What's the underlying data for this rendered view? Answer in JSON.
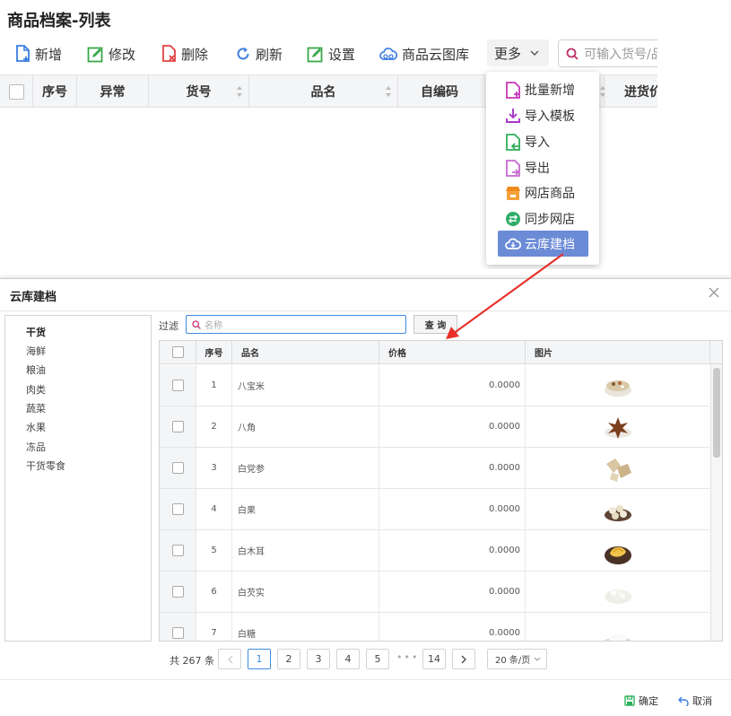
{
  "page": {
    "title": "商品档案-列表",
    "toolbar": {
      "add": "新增",
      "edit": "修改",
      "delete": "删除",
      "refresh": "刷新",
      "settings": "设置",
      "cloud_gallery": "商品云图库",
      "more": "更多",
      "search_placeholder": "可输入货号/品名"
    },
    "columns": [
      "序号",
      "异常",
      "货号",
      "品名",
      "自编码",
      "进货价"
    ]
  },
  "more_menu": [
    {
      "label": "批量新增",
      "icon": "batch-add-icon"
    },
    {
      "label": "导入模板",
      "icon": "download-icon"
    },
    {
      "label": "导入",
      "icon": "import-icon"
    },
    {
      "label": "导出",
      "icon": "export-icon"
    },
    {
      "label": "网店商品",
      "icon": "shop-icon"
    },
    {
      "label": "同步网店",
      "icon": "sync-icon"
    },
    {
      "label": "云库建档",
      "icon": "cloud-icon"
    }
  ],
  "colors": {
    "accent": "#3f8ce0",
    "menu_active": "#6b8bd6",
    "arrow": "#e8302a"
  },
  "modal": {
    "title": "云库建档",
    "categories": [
      "干货",
      "海鲜",
      "粮油",
      "肉类",
      "蔬菜",
      "水果",
      "冻品",
      "干货零食"
    ],
    "filter_label": "过滤",
    "filter_placeholder": "名称",
    "query_button": "查 询",
    "table_columns": {
      "index": "序号",
      "name": "品名",
      "price": "价格",
      "image": "图片"
    },
    "rows": [
      {
        "index": "1",
        "name": "八宝米",
        "price": "0.0000",
        "image": "grains-bowl-image"
      },
      {
        "index": "2",
        "name": "八角",
        "price": "0.0000",
        "image": "star-anise-image"
      },
      {
        "index": "3",
        "name": "白党参",
        "price": "0.0000",
        "image": "root-slices-image"
      },
      {
        "index": "4",
        "name": "白果",
        "price": "0.0000",
        "image": "ginkgo-nuts-image"
      },
      {
        "index": "5",
        "name": "白木耳",
        "price": "0.0000",
        "image": "white-fungus-image"
      },
      {
        "index": "6",
        "name": "白芡实",
        "price": "0.0000",
        "image": "fox-nut-image"
      },
      {
        "index": "7",
        "name": "白糖",
        "price": "0.0000",
        "image": "sugar-image"
      }
    ],
    "pager": {
      "total": "共 267 条",
      "pages": [
        "1",
        "2",
        "3",
        "4",
        "5"
      ],
      "dots": "•••",
      "last": "14",
      "page_size": "20 条/页"
    },
    "footer": {
      "confirm": "确定",
      "cancel": "取消"
    }
  }
}
